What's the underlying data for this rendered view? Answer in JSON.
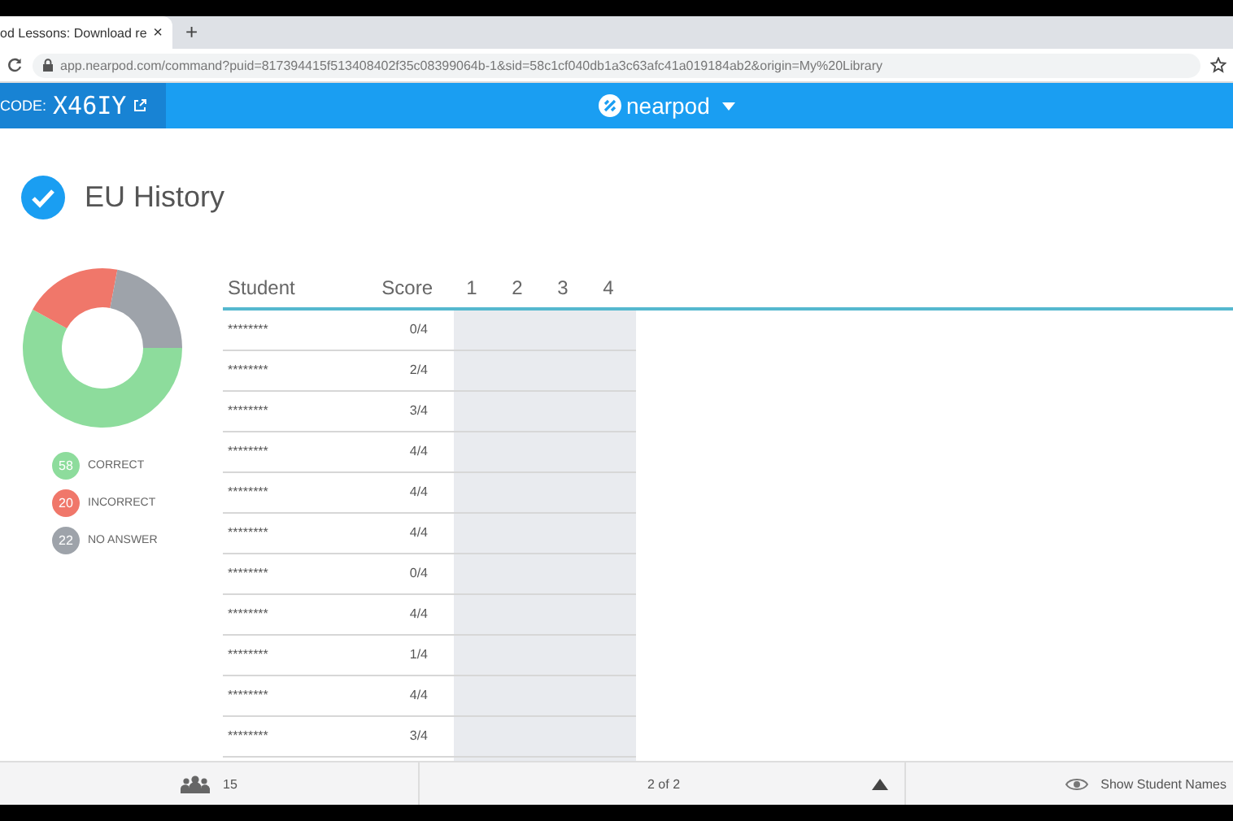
{
  "browser": {
    "tab_title": "od Lessons: Download re",
    "tab_close": "×",
    "new_tab": "+",
    "url": "app.nearpod.com/command?puid=817394415f513408402f35c08399064b-1&sid=58c1cf040db1a3c63afc41a019184ab2&origin=My%20Library"
  },
  "header": {
    "code_label": "CODE:",
    "code": "X46IY",
    "logo_text": "nearpod"
  },
  "lesson": {
    "title": "EU History",
    "completed": true
  },
  "summary": {
    "legend": [
      {
        "count": "58",
        "label": "CORRECT",
        "color": "#8ddc9c"
      },
      {
        "count": "20",
        "label": "INCORRECT",
        "color": "#f0776a"
      },
      {
        "count": "22",
        "label": "NO ANSWER",
        "color": "#9ea3aa"
      }
    ]
  },
  "table": {
    "columns": [
      "Student",
      "Score",
      "1",
      "2",
      "3",
      "4"
    ],
    "rows": [
      {
        "student": "********",
        "score": "0/4"
      },
      {
        "student": "********",
        "score": "2/4"
      },
      {
        "student": "********",
        "score": "3/4"
      },
      {
        "student": "********",
        "score": "4/4"
      },
      {
        "student": "********",
        "score": "4/4"
      },
      {
        "student": "********",
        "score": "4/4"
      },
      {
        "student": "********",
        "score": "0/4"
      },
      {
        "student": "********",
        "score": "4/4"
      },
      {
        "student": "********",
        "score": "1/4"
      },
      {
        "student": "********",
        "score": "4/4"
      },
      {
        "student": "********",
        "score": "3/4"
      }
    ]
  },
  "footer": {
    "students": "15",
    "page": "2 of 2",
    "show_names": "Show Student Names"
  }
}
